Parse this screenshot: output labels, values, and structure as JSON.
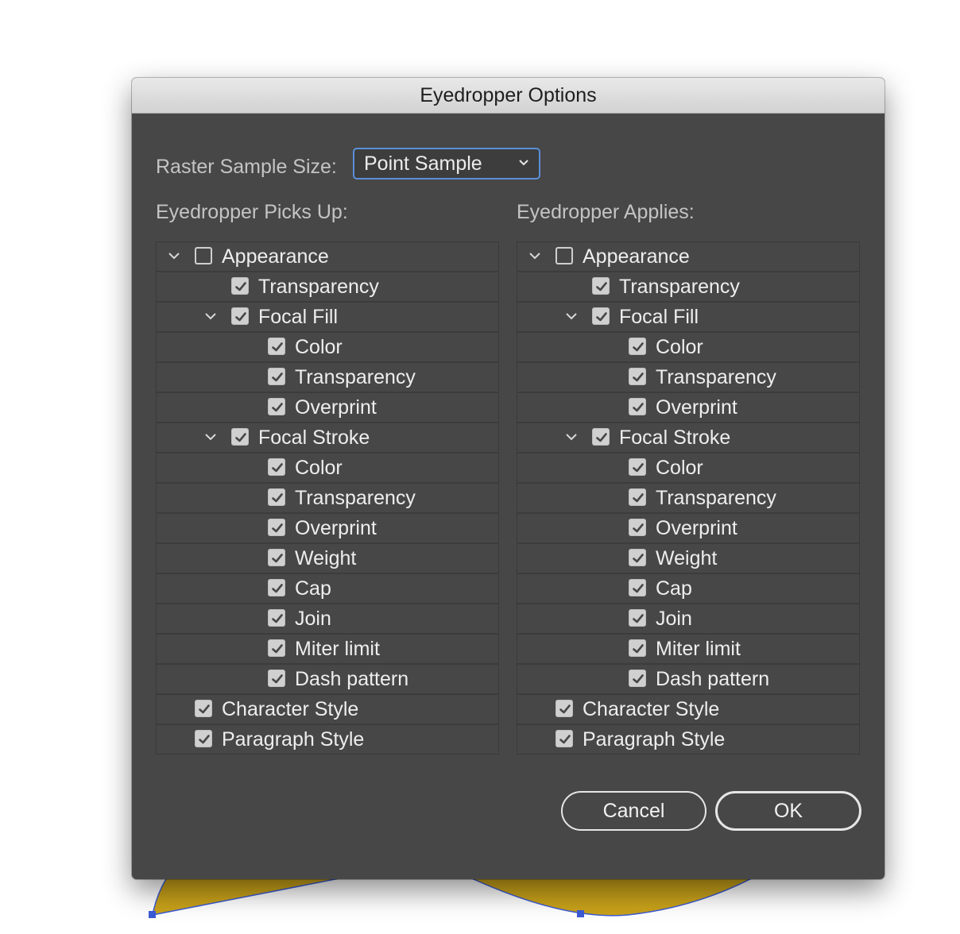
{
  "dialog": {
    "title": "Eyedropper Options",
    "raster_label": "Raster Sample Size:",
    "raster_value": "Point Sample",
    "picks_up_label": "Eyedropper Picks Up:",
    "applies_label": "Eyedropper Applies:",
    "cancel_label": "Cancel",
    "ok_label": "OK"
  },
  "colors": {
    "dialog_bg": "#474747",
    "focus_ring": "#5b8fd8",
    "artwork_fill": "#c9a21a",
    "selection_handle": "#3b5bd6"
  },
  "picks_up": {
    "items": [
      {
        "label": "Appearance",
        "level": 0,
        "expander": true,
        "checked": false,
        "key": "appearance"
      },
      {
        "label": "Transparency",
        "level": 1,
        "expander": false,
        "checked": true,
        "key": "appearance-transparency"
      },
      {
        "label": "Focal Fill",
        "level": 1,
        "expander": true,
        "checked": true,
        "key": "focal-fill"
      },
      {
        "label": "Color",
        "level": 2,
        "expander": false,
        "checked": true,
        "key": "fill-color"
      },
      {
        "label": "Transparency",
        "level": 2,
        "expander": false,
        "checked": true,
        "key": "fill-transparency"
      },
      {
        "label": "Overprint",
        "level": 2,
        "expander": false,
        "checked": true,
        "key": "fill-overprint"
      },
      {
        "label": "Focal Stroke",
        "level": 1,
        "expander": true,
        "checked": true,
        "key": "focal-stroke"
      },
      {
        "label": "Color",
        "level": 2,
        "expander": false,
        "checked": true,
        "key": "stroke-color"
      },
      {
        "label": "Transparency",
        "level": 2,
        "expander": false,
        "checked": true,
        "key": "stroke-transparency"
      },
      {
        "label": "Overprint",
        "level": 2,
        "expander": false,
        "checked": true,
        "key": "stroke-overprint"
      },
      {
        "label": "Weight",
        "level": 2,
        "expander": false,
        "checked": true,
        "key": "stroke-weight"
      },
      {
        "label": "Cap",
        "level": 2,
        "expander": false,
        "checked": true,
        "key": "stroke-cap"
      },
      {
        "label": "Join",
        "level": 2,
        "expander": false,
        "checked": true,
        "key": "stroke-join"
      },
      {
        "label": "Miter limit",
        "level": 2,
        "expander": false,
        "checked": true,
        "key": "stroke-miter-limit"
      },
      {
        "label": "Dash pattern",
        "level": 2,
        "expander": false,
        "checked": true,
        "key": "stroke-dash-pattern"
      },
      {
        "label": "Character Style",
        "level": 0,
        "expander": false,
        "checked": true,
        "key": "character-style"
      },
      {
        "label": "Paragraph Style",
        "level": 0,
        "expander": false,
        "checked": true,
        "key": "paragraph-style"
      }
    ]
  },
  "applies": {
    "items": [
      {
        "label": "Appearance",
        "level": 0,
        "expander": true,
        "checked": false,
        "key": "appearance"
      },
      {
        "label": "Transparency",
        "level": 1,
        "expander": false,
        "checked": true,
        "key": "appearance-transparency"
      },
      {
        "label": "Focal Fill",
        "level": 1,
        "expander": true,
        "checked": true,
        "key": "focal-fill"
      },
      {
        "label": "Color",
        "level": 2,
        "expander": false,
        "checked": true,
        "key": "fill-color"
      },
      {
        "label": "Transparency",
        "level": 2,
        "expander": false,
        "checked": true,
        "key": "fill-transparency"
      },
      {
        "label": "Overprint",
        "level": 2,
        "expander": false,
        "checked": true,
        "key": "fill-overprint"
      },
      {
        "label": "Focal Stroke",
        "level": 1,
        "expander": true,
        "checked": true,
        "key": "focal-stroke"
      },
      {
        "label": "Color",
        "level": 2,
        "expander": false,
        "checked": true,
        "key": "stroke-color"
      },
      {
        "label": "Transparency",
        "level": 2,
        "expander": false,
        "checked": true,
        "key": "stroke-transparency"
      },
      {
        "label": "Overprint",
        "level": 2,
        "expander": false,
        "checked": true,
        "key": "stroke-overprint"
      },
      {
        "label": "Weight",
        "level": 2,
        "expander": false,
        "checked": true,
        "key": "stroke-weight"
      },
      {
        "label": "Cap",
        "level": 2,
        "expander": false,
        "checked": true,
        "key": "stroke-cap"
      },
      {
        "label": "Join",
        "level": 2,
        "expander": false,
        "checked": true,
        "key": "stroke-join"
      },
      {
        "label": "Miter limit",
        "level": 2,
        "expander": false,
        "checked": true,
        "key": "stroke-miter-limit"
      },
      {
        "label": "Dash pattern",
        "level": 2,
        "expander": false,
        "checked": true,
        "key": "stroke-dash-pattern"
      },
      {
        "label": "Character Style",
        "level": 0,
        "expander": false,
        "checked": true,
        "key": "character-style"
      },
      {
        "label": "Paragraph Style",
        "level": 0,
        "expander": false,
        "checked": true,
        "key": "paragraph-style"
      }
    ]
  }
}
